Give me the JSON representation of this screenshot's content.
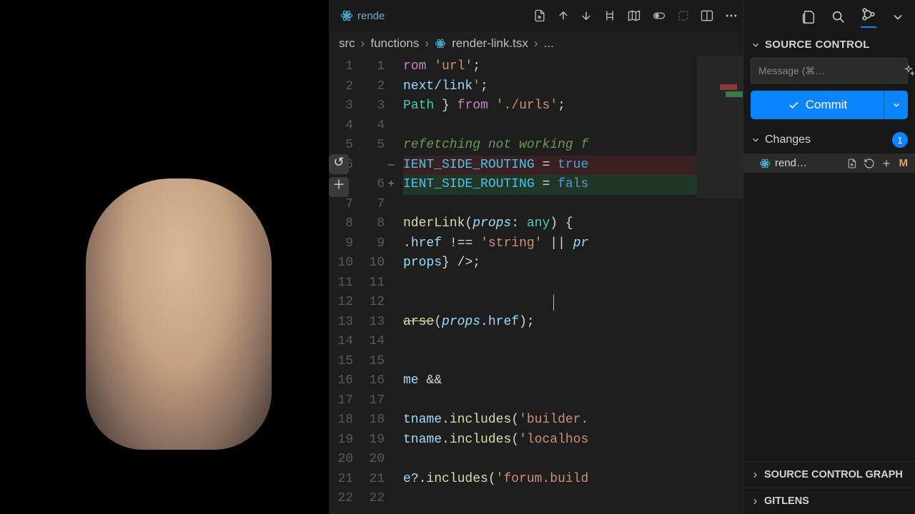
{
  "webcam_visible": true,
  "tab": {
    "label": "rende"
  },
  "breadcrumb": {
    "parts": [
      "src",
      "functions",
      "render-link.tsx",
      "..."
    ]
  },
  "toolbar_icons": [
    "goto-file-icon",
    "arrow-up-icon",
    "arrow-down-icon",
    "whitespace-icon",
    "map-icon",
    "toggle-icon",
    "dashed-box-icon",
    "split-icon",
    "more-icon"
  ],
  "gutter": {
    "revert": "↺",
    "stage": "＋"
  },
  "code": {
    "lines": [
      {
        "l1": "1",
        "l2": "1",
        "kind": "normal",
        "html": "<span class='keyword'>rom</span> <span class='string'>'url'</span><span class='punct'>;</span>"
      },
      {
        "l1": "2",
        "l2": "2",
        "kind": "normal",
        "html": "<span class='prop'>next/link</span><span class='string'>'</span><span class='punct'>;</span>"
      },
      {
        "l1": "3",
        "l2": "3",
        "kind": "normal",
        "html": "<span class='type'>Path</span> <span class='punct'>}</span> <span class='keyword'>from</span> <span class='string'>'./urls'</span><span class='punct'>;</span>"
      },
      {
        "l1": "4",
        "l2": "4",
        "kind": "normal",
        "html": ""
      },
      {
        "l1": "5",
        "l2": "5",
        "kind": "normal",
        "html": "<span class='comment'>refetching not working f</span>"
      },
      {
        "l1": "6",
        "l2": "",
        "kind": "removed",
        "diff": "—",
        "html": "<span class='const-v'>IENT_SIDE_ROUTING</span> <span class='punct'>=</span> <span class='bool'>true</span>"
      },
      {
        "l1": "",
        "l2": "6",
        "kind": "added",
        "diff": "+",
        "html": "<span class='const-v'>IENT_SIDE_ROUTING</span> <span class='punct'>=</span> <span class='bool'>fals</span>"
      },
      {
        "l1": "7",
        "l2": "7",
        "kind": "normal",
        "html": ""
      },
      {
        "l1": "8",
        "l2": "8",
        "kind": "normal",
        "html": "<span class='fn'>nderLink</span><span class='punct'>(</span><span class='param'>props</span><span class='punct'>:</span> <span class='type'>any</span><span class='punct'>) {</span>"
      },
      {
        "l1": "9",
        "l2": "9",
        "kind": "normal",
        "html": "<span class='punct'>.</span><span class='prop'>href</span> <span class='punct'>!==</span> <span class='string'>'string'</span> <span class='punct'>||</span> <span class='param'>pr</span>"
      },
      {
        "l1": "10",
        "l2": "10",
        "kind": "normal",
        "html": "<span class='prop'>props</span><span class='punct'>}</span> <span class='punct'>/&gt;;</span>"
      },
      {
        "l1": "11",
        "l2": "11",
        "kind": "normal",
        "html": ""
      },
      {
        "l1": "12",
        "l2": "12",
        "kind": "cursor",
        "html": ""
      },
      {
        "l1": "13",
        "l2": "13",
        "kind": "normal",
        "html": "<span class='fn struck'>arse</span><span class='punct'>(</span><span class='param'>props</span><span class='punct'>.</span><span class='prop'>href</span><span class='punct'>);</span>"
      },
      {
        "l1": "14",
        "l2": "14",
        "kind": "normal",
        "html": ""
      },
      {
        "l1": "15",
        "l2": "15",
        "kind": "normal",
        "html": ""
      },
      {
        "l1": "16",
        "l2": "16",
        "kind": "normal",
        "html": "<span class='prop'>me</span> <span class='punct'>&amp;&amp;</span>"
      },
      {
        "l1": "17",
        "l2": "17",
        "kind": "normal",
        "html": ""
      },
      {
        "l1": "18",
        "l2": "18",
        "kind": "normal",
        "html": "<span class='prop'>tname</span><span class='punct'>.</span><span class='fn'>includes</span><span class='punct'>(</span><span class='string'>'builder.</span>"
      },
      {
        "l1": "19",
        "l2": "19",
        "kind": "normal",
        "html": "<span class='prop'>tname</span><span class='punct'>.</span><span class='fn'>includes</span><span class='punct'>(</span><span class='string'>'localhos</span>"
      },
      {
        "l1": "20",
        "l2": "20",
        "kind": "normal",
        "html": ""
      },
      {
        "l1": "21",
        "l2": "21",
        "kind": "normal",
        "html": "<span class='prop'>e</span><span class='punct'>?.</span><span class='fn'>includes</span><span class='punct'>(</span><span class='string'>'forum.build</span>"
      },
      {
        "l1": "22",
        "l2": "22",
        "kind": "normal",
        "html": ""
      }
    ]
  },
  "scm": {
    "title": "SOURCE CONTROL",
    "message_placeholder": "Message (⌘…",
    "commit_label": "Commit",
    "changes_label": "Changes",
    "changes_count": "1",
    "file": {
      "name": "rend…",
      "status": "M"
    },
    "sections": {
      "graph": "SOURCE CONTROL GRAPH",
      "gitlens": "GITLENS"
    }
  }
}
